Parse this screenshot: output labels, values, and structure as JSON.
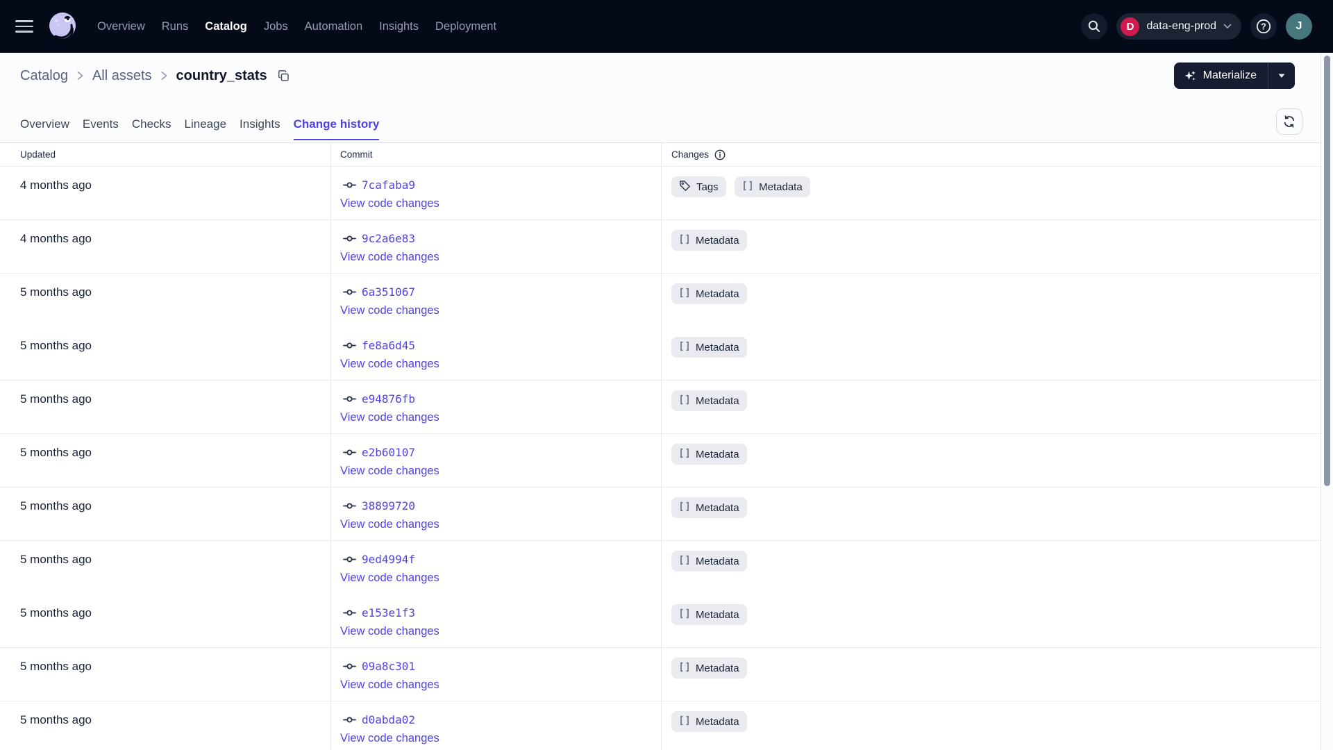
{
  "colors": {
    "nav_bg": "#050a18",
    "accent": "#4f43dd",
    "ws_badge": "#d11b4e",
    "avatar_bg": "#47767c",
    "badge_bg": "#e9ebf1",
    "logo": "#c9c6f4"
  },
  "nav": {
    "items": [
      {
        "label": "Overview",
        "active": false
      },
      {
        "label": "Runs",
        "active": false
      },
      {
        "label": "Catalog",
        "active": true
      },
      {
        "label": "Jobs",
        "active": false
      },
      {
        "label": "Automation",
        "active": false
      },
      {
        "label": "Insights",
        "active": false
      },
      {
        "label": "Deployment",
        "active": false
      }
    ],
    "icons": [
      "menu-icon",
      "dagster-logo",
      "search-icon",
      "chevron-down-icon",
      "help-icon"
    ],
    "workspace": {
      "initial": "D",
      "name": "data-eng-prod"
    },
    "avatar_initial": "J"
  },
  "breadcrumb": {
    "links": [
      "Catalog",
      "All assets"
    ],
    "current": "country_stats",
    "copy_icon": "copy-icon"
  },
  "page_actions": {
    "materialize_label": "Materialize",
    "materialize_icon": "sparkles-icon",
    "refresh_icon": "refresh-icon"
  },
  "tabs": {
    "items": [
      {
        "label": "Overview",
        "active": false
      },
      {
        "label": "Events",
        "active": false
      },
      {
        "label": "Checks",
        "active": false
      },
      {
        "label": "Lineage",
        "active": false
      },
      {
        "label": "Insights",
        "active": false
      },
      {
        "label": "Change history",
        "active": true
      }
    ]
  },
  "table": {
    "columns": {
      "updated": "Updated",
      "commit": "Commit",
      "changes": "Changes"
    },
    "changes_info_icon": "info-icon",
    "commit_icon": "git-commit-icon",
    "view_code_label": "View code changes",
    "rows": [
      {
        "updated": "4 months ago",
        "commit": "7cafaba9",
        "changes": [
          {
            "label": "Tags",
            "icon": "tag-icon"
          },
          {
            "label": "Metadata",
            "icon": "brackets-icon"
          }
        ],
        "divider_below": true
      },
      {
        "updated": "4 months ago",
        "commit": "9c2a6e83",
        "changes": [
          {
            "label": "Metadata",
            "icon": "brackets-icon"
          }
        ],
        "divider_below": true
      },
      {
        "updated": "5 months ago",
        "commit": "6a351067",
        "changes": [
          {
            "label": "Metadata",
            "icon": "brackets-icon"
          }
        ],
        "divider_below": false
      },
      {
        "updated": "5 months ago",
        "commit": "fe8a6d45",
        "changes": [
          {
            "label": "Metadata",
            "icon": "brackets-icon"
          }
        ],
        "divider_below": true
      },
      {
        "updated": "5 months ago",
        "commit": "e94876fb",
        "changes": [
          {
            "label": "Metadata",
            "icon": "brackets-icon"
          }
        ],
        "divider_below": true
      },
      {
        "updated": "5 months ago",
        "commit": "e2b60107",
        "changes": [
          {
            "label": "Metadata",
            "icon": "brackets-icon"
          }
        ],
        "divider_below": true
      },
      {
        "updated": "5 months ago",
        "commit": "38899720",
        "changes": [
          {
            "label": "Metadata",
            "icon": "brackets-icon"
          }
        ],
        "divider_below": true
      },
      {
        "updated": "5 months ago",
        "commit": "9ed4994f",
        "changes": [
          {
            "label": "Metadata",
            "icon": "brackets-icon"
          }
        ],
        "divider_below": false
      },
      {
        "updated": "5 months ago",
        "commit": "e153e1f3",
        "changes": [
          {
            "label": "Metadata",
            "icon": "brackets-icon"
          }
        ],
        "divider_below": true
      },
      {
        "updated": "5 months ago",
        "commit": "09a8c301",
        "changes": [
          {
            "label": "Metadata",
            "icon": "brackets-icon"
          }
        ],
        "divider_below": true
      },
      {
        "updated": "5 months ago",
        "commit": "d0abda02",
        "changes": [
          {
            "label": "Metadata",
            "icon": "brackets-icon"
          }
        ],
        "divider_below": true
      }
    ]
  }
}
